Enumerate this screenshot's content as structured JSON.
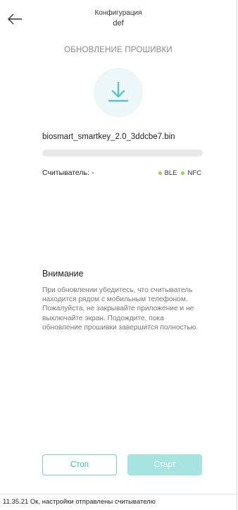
{
  "header": {
    "title": "Конфигурация",
    "subtitle": "def"
  },
  "section": {
    "heading": "ОБНОВЛЕНИЕ ПРОШИВКИ",
    "icon": "download-icon"
  },
  "firmware": {
    "filename": "biosmart_smartkey_2.0_3ddcbe7.bin",
    "progress_fraction": 0.0
  },
  "reader": {
    "label": "Считыватель: -",
    "protocols": [
      {
        "label": "BLE",
        "color": "#9ad04e"
      },
      {
        "label": "NFC",
        "color": "#9ad04e"
      }
    ]
  },
  "warning": {
    "heading": "Внимание",
    "text": "При обновлении убедитесь, что считыватель находится рядом с мобильным телефоном. Пожалуйста, не закрывайте приложение и не выключайте экран. Подождите, пока обновление прошивки завершится полностью."
  },
  "buttons": {
    "stop_label": "Стоп",
    "start_label": "Старт"
  },
  "status": {
    "message": "11.35.21 Ок, настройки отправлены считывателю"
  },
  "colors": {
    "accent": "#7ccfcf",
    "accent_light": "#a6e3e1",
    "ble_dot": "#9ad04e",
    "nfc_dot": "#9ad04e"
  }
}
